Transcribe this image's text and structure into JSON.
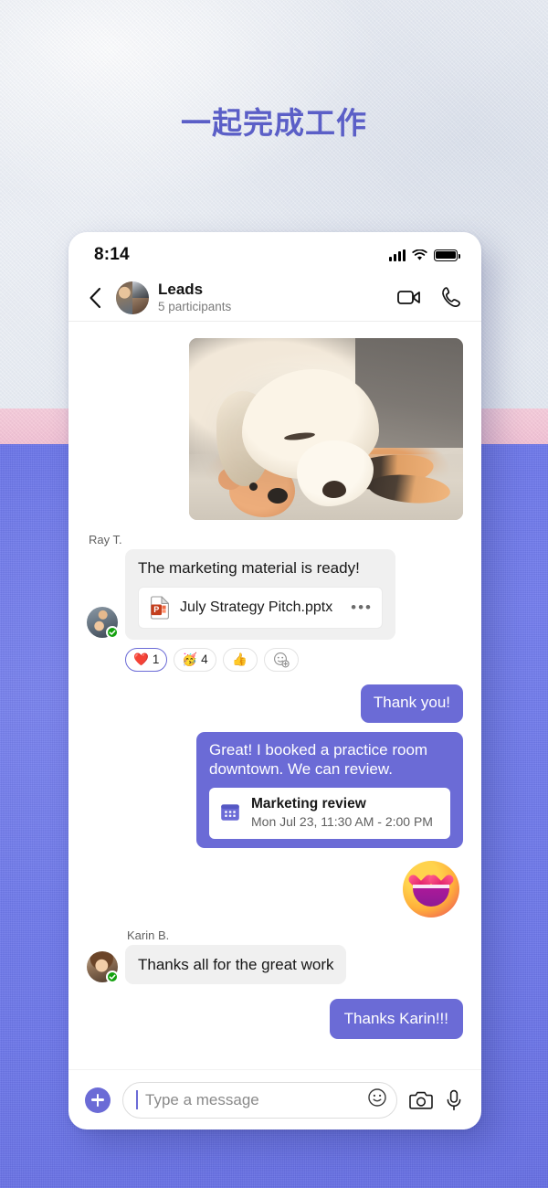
{
  "headline": "一起完成工作",
  "theme": {
    "accent": "#6b6bd6",
    "headline_color": "#5b5fc7",
    "presence_color": "#13a10e"
  },
  "statusbar": {
    "time": "8:14",
    "signal": "signal-bars-icon",
    "wifi": "wifi-icon",
    "battery": "battery-full-icon"
  },
  "header": {
    "back": "back-chevron-icon",
    "title": "Leads",
    "subtitle": "5 participants",
    "video_call": "video-camera-icon",
    "audio_call": "phone-handset-icon"
  },
  "messages": {
    "photo": {
      "alt": "sleeping-labrador-with-plush-toy"
    },
    "ray": {
      "sender": "Ray T.",
      "text": "The marketing material is ready!",
      "file": {
        "name": "July Strategy Pitch.pptx",
        "icon": "powerpoint-file-icon",
        "overflow": "•••"
      },
      "reactions": [
        {
          "icon": "heart-reaction-icon",
          "emoji": "❤️",
          "count": "1",
          "selected": true
        },
        {
          "icon": "party-face-reaction-icon",
          "emoji": "🥳",
          "count": "4",
          "selected": false
        },
        {
          "icon": "thumbs-up-reaction-icon",
          "emoji": "👍",
          "count": "",
          "selected": false
        },
        {
          "icon": "add-reaction-icon",
          "emoji": "",
          "count": "",
          "selected": false
        }
      ]
    },
    "out_thanks": "Thank you!",
    "out_booked": "Great! I booked a practice room downtown. We can review.",
    "event": {
      "icon": "calendar-icon",
      "title": "Marketing review",
      "time": "Mon Jul 23, 11:30 AM - 2:00 PM"
    },
    "big_emoji": {
      "icon": "heart-eyes-emoji",
      "glyph": "😍"
    },
    "karin": {
      "sender": "Karin B.",
      "text": "Thanks all for the great work"
    },
    "out_thanks_karin": "Thanks Karin!!!"
  },
  "composer": {
    "add": "plus-icon",
    "placeholder": "Type a message",
    "value": "",
    "emoji": "emoji-smiley-icon",
    "camera": "camera-icon",
    "mic": "microphone-icon"
  }
}
